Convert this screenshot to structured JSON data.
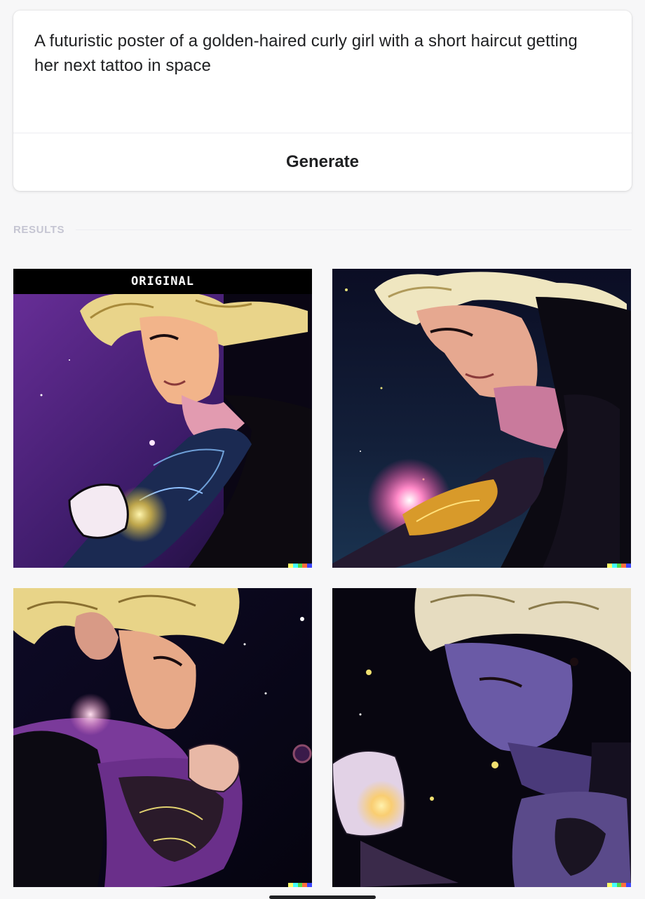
{
  "prompt": {
    "text": "A futuristic poster of a golden-haired curly girl with a short haircut getting her next tattoo in space"
  },
  "generate_button": {
    "label": "Generate"
  },
  "results": {
    "label": "RESULTS",
    "tiles": [
      {
        "badge": "ORIGINAL"
      }
    ]
  },
  "colors": {
    "accent_signature": [
      "#ffff66",
      "#42ffff",
      "#51da4c",
      "#ff6e3c",
      "#3c46ff"
    ]
  }
}
